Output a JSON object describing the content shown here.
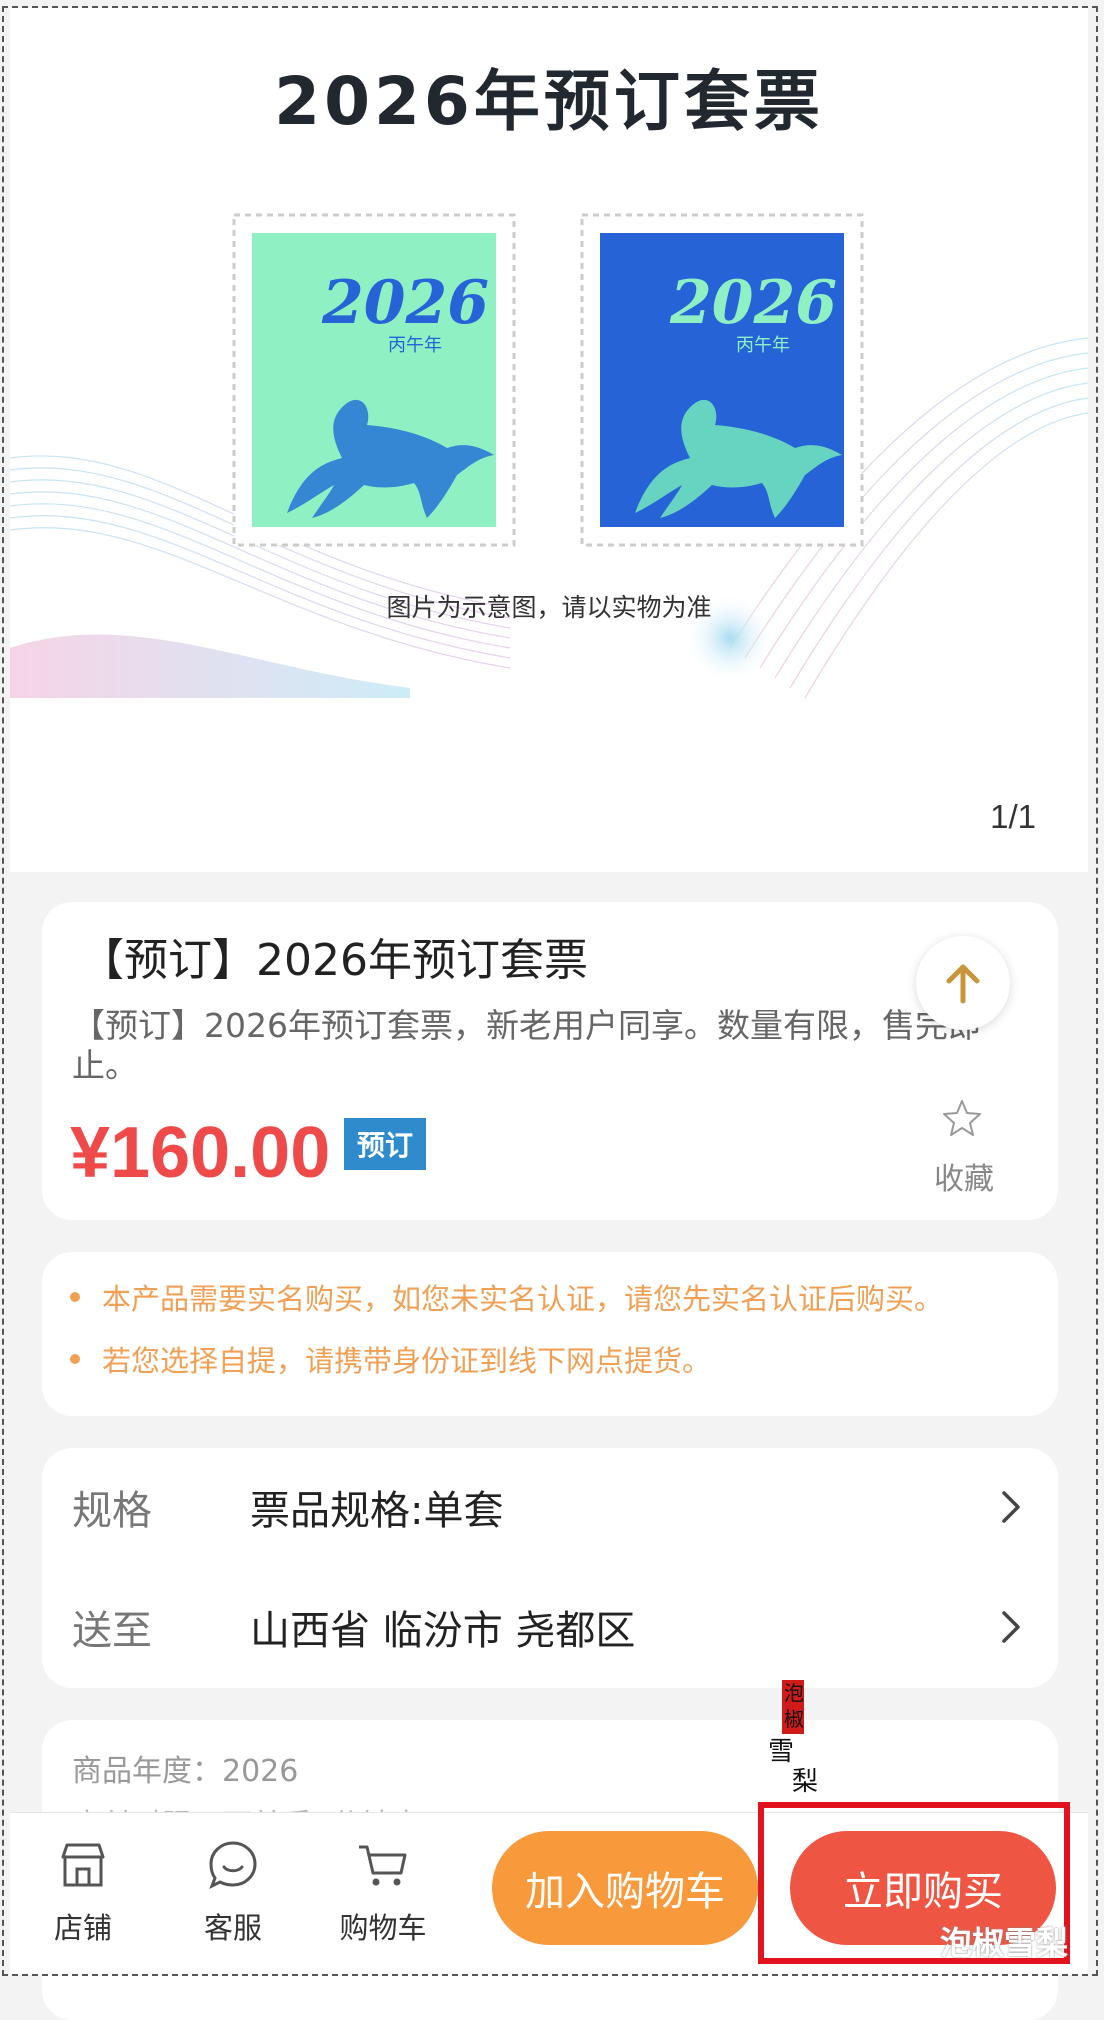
{
  "hero": {
    "title": "2026年预订套票",
    "stamp_year": "2026",
    "stamp_subtitle": "丙午年",
    "caption": "图片为示意图，请以实物为准",
    "pager": "1/1",
    "stamp_colors": [
      "#8ff0c4",
      "#2563d6"
    ]
  },
  "product": {
    "title": "【预订】2026年预订套票",
    "description": "【预订】2026年预订套票，新老用户同享。数量有限，售完即止。",
    "price": "¥160.00",
    "badge": "预订",
    "favorite_label": "收藏"
  },
  "notices": [
    "本产品需要实名购买，如您未实名认证，请您先实名认证后购买。",
    "若您选择自提，请携带身份证到线下网点提货。"
  ],
  "spec": {
    "label": "规格",
    "value": "票品规格:单套"
  },
  "delivery": {
    "label": "送至",
    "value": "山西省 临汾市 尧都区"
  },
  "info": {
    "year_line": "商品年度：2026",
    "pay_line": "支付时限：下单后1分钟内"
  },
  "bottom_bar": {
    "store": "店铺",
    "service": "客服",
    "cart": "购物车",
    "add_to_cart": "加入购物车",
    "buy_now": "立即购买"
  },
  "watermark": {
    "text": "泡椒雪梨"
  },
  "colors": {
    "price": "#ef4a4a",
    "add_to_cart": "#f8993b",
    "buy_now": "#ef5543",
    "notice": "#f0a054",
    "badge": "#2f8bcb"
  }
}
